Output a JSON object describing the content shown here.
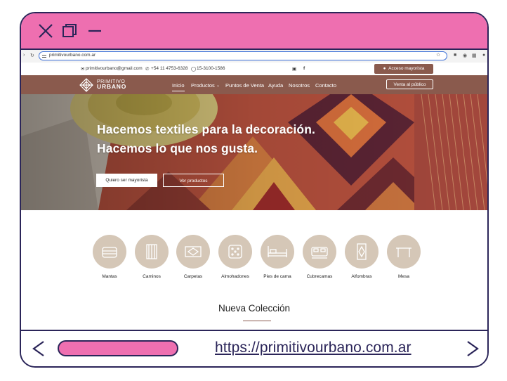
{
  "app": {
    "window_controls": [
      "close-icon",
      "restore-icon",
      "minimize-icon"
    ],
    "display_url": "https://primitivourbano.com.ar"
  },
  "browser": {
    "address": "primitivourbano.com.ar"
  },
  "site": {
    "contact": {
      "email": "primitivourbano@gmail.com",
      "phone": "+54 11 4753-6328",
      "whatsapp": "15-3100-1586"
    },
    "access_button": "Acceso mayorista",
    "logo": {
      "line1": "PRIMITIVO",
      "line2": "URBANO"
    },
    "nav": [
      "Inicio",
      "Productos",
      "Puntos de Venta",
      "Ayuda",
      "Nosotros",
      "Contacto"
    ],
    "public_button": "Venta al público",
    "hero": {
      "line1": "Hacemos textiles para la decoración.",
      "line2": "Hacemos lo que nos gusta.",
      "primary_button": "Quiero ser mayorista",
      "secondary_button": "Ver productos"
    },
    "categories": [
      "Mantas",
      "Caminos",
      "Carpetas",
      "Almohadones",
      "Pies de cama",
      "Cubrecamas",
      "Alfombras",
      "Mesa"
    ],
    "section_title": "Nueva Colección"
  },
  "colors": {
    "frame_accent": "#ee6fb0",
    "frame_outline": "#2b2559",
    "brand_brown": "#8a5a4d",
    "category_circle": "#d5c7b7"
  }
}
